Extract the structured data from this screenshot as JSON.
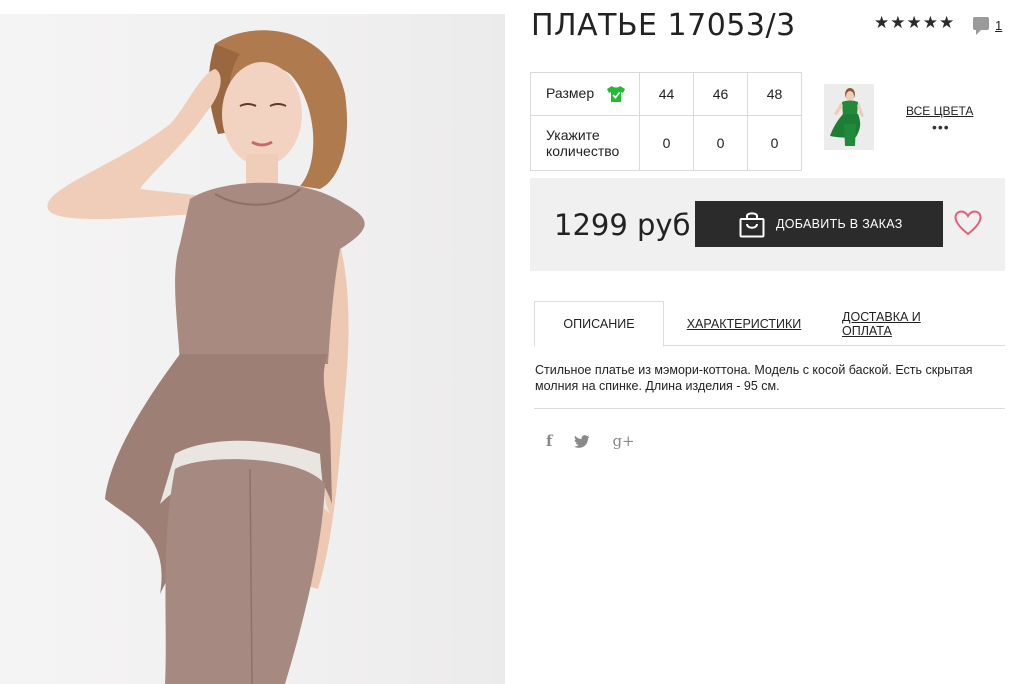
{
  "product": {
    "title": "ПЛАТЬЕ 17053/3",
    "rating_stars": 5,
    "comments_count": "1",
    "price": "1299 руб"
  },
  "sizes": {
    "size_label": "Размер",
    "qty_label": "Укажите количество",
    "values": [
      "44",
      "46",
      "48"
    ],
    "quantities": [
      "0",
      "0",
      "0"
    ]
  },
  "colors": {
    "all_colors_label": "ВСЕ ЦВЕТА",
    "more": "•••",
    "thumb_color": "#1f8a3a"
  },
  "cart": {
    "add_label": "ДОБАВИТЬ В ЗАКАЗ"
  },
  "tabs": [
    {
      "label": "ОПИСАНИЕ",
      "active": true
    },
    {
      "label": "ХАРАКТЕРИСТИКИ",
      "active": false
    },
    {
      "label": "ДОСТАВКА И ОПЛАТА",
      "active": false
    }
  ],
  "description": "Стильное платье из мэмори-коттона. Модель с косой баской. Есть скрытая молния на спинке. Длина изделия - 95 см.",
  "social": {
    "facebook": "f",
    "google": "g+"
  },
  "theme": {
    "dress_color": "#a5857c",
    "button_bg": "#2b2b2b",
    "heart_color": "#e0607a",
    "shirt_icon_color": "#22bb33"
  }
}
